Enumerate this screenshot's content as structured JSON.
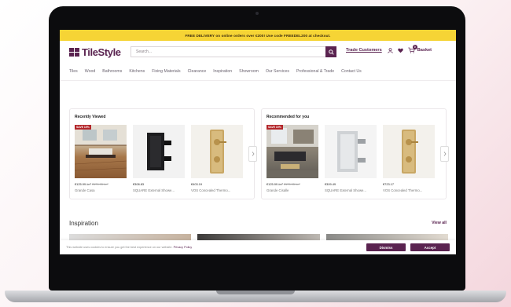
{
  "promo": {
    "text": "FREE DELIVERY on online orders over €200! Use code FREEDEL200 at checkout."
  },
  "brand": {
    "logo_text": "TileStyle",
    "accent": "#5a2350",
    "promo_bg": "#f6d435"
  },
  "search": {
    "placeholder": "Search..."
  },
  "header": {
    "trade_link": "Trade Customers",
    "basket_label": "Basket",
    "basket_count": "0"
  },
  "nav": {
    "items": [
      "Tiles",
      "Wood",
      "Bathrooms",
      "Kitchens",
      "Fixing Materials",
      "Clearance",
      "Inspiration",
      "Showroom",
      "Our Services",
      "Professional & Trade",
      "Contact Us"
    ]
  },
  "recently_viewed": {
    "title": "Recently Viewed",
    "products": [
      {
        "badge": "SAVE 15%",
        "price": "€125.99 /m²",
        "was": "€179.95 /m²",
        "name": "Grande Casa",
        "image": "wood-floor-room"
      },
      {
        "badge": "",
        "price": "€308.83",
        "was": "",
        "name": "SQUARE External Showe...",
        "image": "black-mixer"
      },
      {
        "badge": "",
        "price": "€403.19",
        "was": "",
        "name": "VOS Concealed Thermo...",
        "image": "brass-thermostat"
      }
    ]
  },
  "recommended": {
    "title": "Recommended for you",
    "products": [
      {
        "badge": "SAVE 15%",
        "price": "€125.99 /m²",
        "was": "€179.95 /m²",
        "name": "Grande Cisalle",
        "image": "living-room-floor"
      },
      {
        "badge": "",
        "price": "€309.49",
        "was": "",
        "name": "SQUARE External Showe...",
        "image": "chrome-mixer"
      },
      {
        "badge": "",
        "price": "€723.17",
        "was": "",
        "name": "VOS Concealed Thermo...",
        "image": "brass-thermostat"
      }
    ]
  },
  "inspiration": {
    "title": "Inspiration",
    "view_all": "View all"
  },
  "cookie": {
    "text": "This website uses cookies to ensure you get the best experience on our website.",
    "link": "Privacy Policy",
    "dismiss": "Dismiss",
    "accept": "Accept"
  }
}
